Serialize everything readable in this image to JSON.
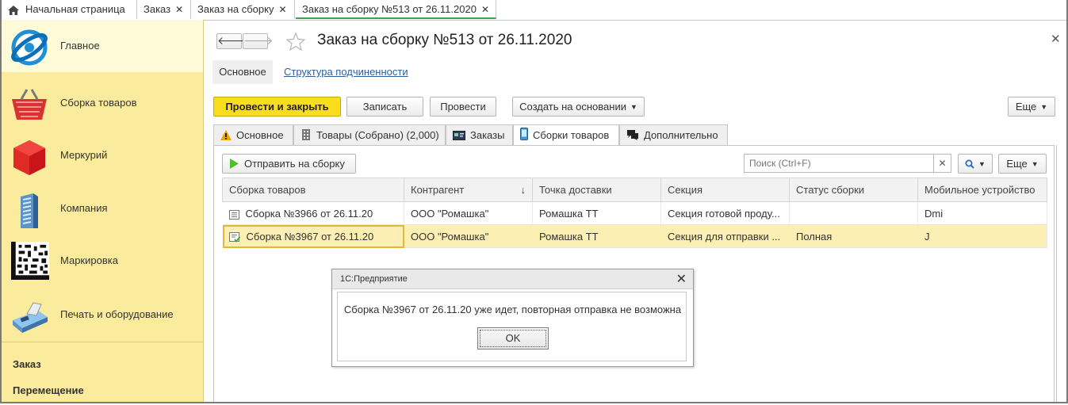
{
  "top_tabs": [
    {
      "label": "Начальная страница"
    },
    {
      "label": "Заказ"
    },
    {
      "label": "Заказ на сборку"
    },
    {
      "label": "Заказ на сборку №513 от 26.11.2020"
    }
  ],
  "sidebar": {
    "items": [
      {
        "label": "Главное",
        "icon": "globe-icon"
      },
      {
        "label": "Сборка товаров",
        "icon": "basket-icon"
      },
      {
        "label": "Меркурий",
        "icon": "red-cube-icon"
      },
      {
        "label": "Компания",
        "icon": "building-icon"
      },
      {
        "label": "Маркировка",
        "icon": "datamatrix-icon"
      },
      {
        "label": "Печать и оборудование",
        "icon": "cash-register-icon"
      }
    ],
    "links": [
      "Заказ",
      "Перемещение"
    ]
  },
  "form": {
    "title": "Заказ на сборку №513 от 26.11.2020",
    "subtabs": {
      "main": "Основное",
      "structure": "Структура подчиненности"
    },
    "toolbar": {
      "post_close": "Провести и закрыть",
      "write": "Записать",
      "post": "Провести",
      "create_based": "Создать на основании",
      "more": "Еще"
    },
    "tabs": [
      {
        "label": "Основное",
        "icon": "warning-icon"
      },
      {
        "label": "Товары (Собрано) (2,000)",
        "icon": "building-icon"
      },
      {
        "label": "Заказы",
        "icon": "card-icon"
      },
      {
        "label": "Сборки товаров",
        "icon": "phone-icon"
      },
      {
        "label": "Дополнительно",
        "icon": "chat-icon"
      }
    ],
    "list_toolbar": {
      "send": "Отправить на сборку",
      "search_placeholder": "Поиск (Ctrl+F)",
      "more": "Еще"
    },
    "table": {
      "columns": [
        "Сборка товаров",
        "Контрагент",
        "Точка доставки",
        "Секция",
        "Статус сборки",
        "Мобильное устройство"
      ],
      "sort_indicator": "↓",
      "rows": [
        {
          "doc": "Сборка №3966 от 26.11.20",
          "counterparty": "ООО \"Ромашка\"",
          "point": "Ромашка ТТ",
          "section": "Секция готовой проду...",
          "status": "",
          "device": "Dmi"
        },
        {
          "doc": "Сборка №3967 от 26.11.20",
          "counterparty": "ООО \"Ромашка\"",
          "point": "Ромашка ТТ",
          "section": "Секция для отправки ...",
          "status": "Полная",
          "device": "J"
        }
      ]
    }
  },
  "dialog": {
    "title": "1С:Предприятие",
    "message": "Сборка №3967 от 26.11.20 уже идет, повторная отправка не возможна",
    "ok": "OK"
  }
}
